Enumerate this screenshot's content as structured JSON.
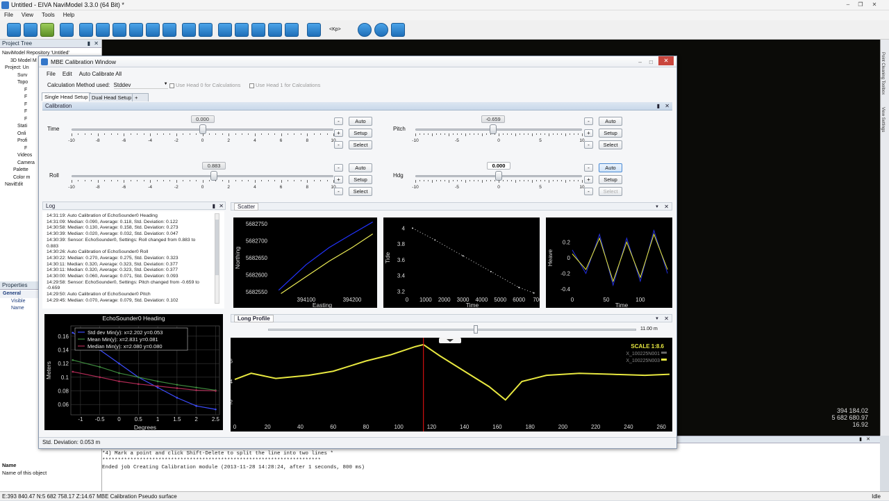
{
  "app": {
    "title": "Untitled - EIVA NaviModel 3.3.0 (64 Bit) *",
    "menu": [
      "File",
      "View",
      "Tools",
      "Help"
    ],
    "kp_label": "<Kp>"
  },
  "project_tree": {
    "title": "Project Tree",
    "items": [
      "NaviModel Repository 'Untitled'",
      "3D Model M",
      "Project: Un",
      "Surv",
      "Topo",
      "F",
      "F",
      "F",
      "F",
      "F",
      "Stati",
      "Onli",
      "Profi",
      "F",
      "Videos",
      "Camera",
      "Palette",
      "Color m",
      "NaviEdit"
    ]
  },
  "properties": {
    "title": "Properties",
    "rows": [
      "General",
      "Visible",
      "Name"
    ],
    "footer_label": "Name",
    "footer_desc": "Name of this object"
  },
  "viewport": {
    "coords": [
      "394 184.02",
      "5 682 680.97",
      "16.92"
    ]
  },
  "right_strip": {
    "tabs": [
      "Point Cleaning Toolbox",
      "View Settings"
    ]
  },
  "output": {
    "lines": [
      "*4) Mark a point and click Shift-Delete to split the line into two lines *",
      "**********************************************************************",
      "Ended job Creating Calibration module (2013-11-28 14:28:24, after 1 seconds, 800 ms)"
    ]
  },
  "status": {
    "left": "E:393 840.47 N:5 682 758.17 Z:14.67 MBE Calibration Pseudo surface",
    "right": "Idle"
  },
  "dialog": {
    "title": "MBE Calibration Window",
    "menu": [
      "File",
      "Edit",
      "Auto Calibrate All"
    ],
    "method_label": "Calculation Method used:",
    "method_value": "Stddev",
    "head0": "Use Head 0 for Calculations",
    "head1": "Use Head 1 for Calculations",
    "tabs": [
      "Single Head Setup",
      "Dual Head Setup",
      "+"
    ],
    "calibration_title": "Calibration",
    "status_text": "Std. Deviation: 0.053 m",
    "sliders": [
      {
        "label": "Time",
        "value": "0.000",
        "fraction": 0.5,
        "ticks": [
          "-10",
          "-8",
          "-6",
          "-4",
          "-2",
          "0",
          "2",
          "4",
          "6",
          "8",
          "10"
        ]
      },
      {
        "label": "Pitch",
        "value": "-0.659",
        "fraction": 0.467,
        "ticks": [
          "-10",
          "-5",
          "0",
          "5",
          "10"
        ]
      },
      {
        "label": "Roll",
        "value": "0.883",
        "fraction": 0.544,
        "ticks": [
          "-10",
          "-8",
          "-6",
          "-4",
          "-2",
          "0",
          "2",
          "4",
          "6",
          "8",
          "10"
        ]
      },
      {
        "label": "Hdg",
        "value": "0.000",
        "fraction": 0.5,
        "ticks": [
          "-10",
          "-5",
          "0",
          "5",
          "10"
        ]
      }
    ],
    "buttons": {
      "auto": "Auto",
      "setup": "Setup",
      "select": "Select",
      "minus": "-",
      "plus": "+"
    },
    "log": {
      "title": "Log",
      "lines": [
        "14:31:19: Auto Calibration of EchoSounder0 Heading",
        "14:31:09: Median: 0.090, Average: 0.118, Std. Deviation: 0.122",
        "14:30:58: Median: 0.130, Average: 0.158, Std. Deviation: 0.273",
        "14:30:39: Median: 0.020, Average: 0.032, Std. Deviation: 0.047",
        "14:30:39: Sensor: EchoSounder0, Settings: Roll changed from 0.883 to",
        "0.883",
        "14:30:26: Auto Calibration of EchoSounder0 Roll",
        "14:30:22: Median: 0.270, Average: 0.275, Std. Deviation: 0.323",
        "14:30:11: Median: 0.320, Average: 0.323, Std. Deviation: 0.377",
        "14:30:11: Median: 0.320, Average: 0.323, Std. Deviation: 0.377",
        "14:30:00: Median: 0.060, Average: 0.071, Std. Deviation: 0.093",
        "14:29:58: Sensor: EchoSounder0, Settings: Pitch changed from -0.659 to",
        "-0.659",
        "14:29:50: Auto Calibration of EchoSounder0 Pitch",
        "14:29:45: Median: 0.070, Average: 0.079, Std. Deviation: 0.102"
      ]
    },
    "scatter_title": "Scatter",
    "long_profile": {
      "title": "Long Profile",
      "slider_label": "11.00 m",
      "scale_label": "SCALE 1:8.6",
      "legend": [
        "X_100225N001",
        "X_100225N003"
      ]
    }
  },
  "chart_data": [
    {
      "type": "line",
      "title": "EchoSounder0 Heading",
      "xlabel": "Degrees",
      "ylabel": "Meters",
      "xlim": [
        -1.25,
        2.6
      ],
      "ylim": [
        0.045,
        0.175
      ],
      "xticks": [
        "-1",
        "-0.5",
        "0",
        "0.5",
        "1",
        "1.5",
        "2",
        "2.5"
      ],
      "yticks": [
        "0.16",
        "0.14",
        "0.12",
        "0.1",
        "0.08",
        "0.06"
      ],
      "legend": [
        "Std dev   Min(y): x=2.202   y=0.053",
        "Mean      Min(y): x=2.831   y=0.081",
        "Median    Min(y): x=2.080   y=0.080"
      ],
      "series": [
        {
          "name": "Std dev",
          "color": "#3d4dff",
          "x": [
            -1.2,
            -0.5,
            0,
            0.5,
            1,
            1.5,
            2,
            2.5
          ],
          "y": [
            0.165,
            0.14,
            0.12,
            0.1,
            0.085,
            0.07,
            0.058,
            0.053
          ]
        },
        {
          "name": "Mean",
          "color": "#3e8a3e",
          "x": [
            -1.2,
            -0.5,
            0,
            0.5,
            1,
            1.5,
            2,
            2.5
          ],
          "y": [
            0.125,
            0.115,
            0.106,
            0.1,
            0.094,
            0.089,
            0.085,
            0.081
          ]
        },
        {
          "name": "Median",
          "color": "#b02a55",
          "x": [
            -1.2,
            -0.5,
            0,
            0.5,
            1,
            1.5,
            2,
            2.5
          ],
          "y": [
            0.108,
            0.1,
            0.094,
            0.09,
            0.087,
            0.084,
            0.081,
            0.08
          ]
        }
      ]
    },
    {
      "type": "scatter",
      "xlabel": "Easting",
      "ylabel": "Northing",
      "xlim": [
        394020,
        394250
      ],
      "ylim": [
        5682540,
        5682760
      ],
      "xticks": [
        "394100",
        "394200"
      ],
      "yticks": [
        "5682750",
        "5682700",
        "5682650",
        "5682600",
        "5682550"
      ],
      "series": [
        {
          "name": "Head",
          "color": "#2233ff",
          "x": [
            394040,
            394100,
            394150,
            394200,
            394245
          ],
          "y": [
            5682555,
            5682630,
            5682680,
            5682720,
            5682755
          ]
        },
        {
          "name": "Track",
          "color": "#eeee55",
          "x": [
            394045,
            394100,
            394150,
            394200,
            394245
          ],
          "y": [
            5682545,
            5682595,
            5682640,
            5682680,
            5682720
          ]
        }
      ]
    },
    {
      "type": "scatter",
      "xlabel": "Time",
      "ylabel": "Tide",
      "xlim": [
        0,
        7000
      ],
      "ylim": [
        3.15,
        4.1
      ],
      "xticks": [
        "0",
        "1000",
        "2000",
        "3000",
        "4000",
        "5000",
        "6000",
        "700"
      ],
      "yticks": [
        "4",
        "3.8",
        "3.6",
        "3.4",
        "3.2"
      ],
      "series": [
        {
          "name": "Tide",
          "color": "#dddddd",
          "x": [
            300,
            1500,
            3000,
            4500,
            6000,
            6800
          ],
          "y": [
            4.0,
            3.85,
            3.65,
            3.45,
            3.25,
            3.18
          ]
        }
      ]
    },
    {
      "type": "line",
      "xlabel": "Time",
      "ylabel": "Heave",
      "xlim": [
        0,
        145
      ],
      "ylim": [
        -0.48,
        0.48
      ],
      "xticks": [
        "0",
        "50",
        "100"
      ],
      "yticks": [
        "0.2",
        "0",
        "-0.2",
        "-0.4"
      ],
      "series": [
        {
          "name": "Heave raw",
          "color": "#2230e0",
          "x": [
            0,
            20,
            40,
            60,
            80,
            100,
            120,
            140
          ],
          "y": [
            0.1,
            -0.2,
            0.3,
            -0.35,
            0.25,
            -0.3,
            0.35,
            -0.2
          ]
        },
        {
          "name": "Heave",
          "color": "#eeee33",
          "x": [
            0,
            20,
            40,
            60,
            80,
            100,
            120,
            140
          ],
          "y": [
            0.05,
            -0.15,
            0.25,
            -0.3,
            0.2,
            -0.25,
            0.3,
            -0.15
          ]
        }
      ]
    },
    {
      "type": "line",
      "title": "",
      "xlim": [
        0,
        265
      ],
      "ylim": [
        10,
        18
      ],
      "xticks": [
        "0",
        "20",
        "40",
        "60",
        "80",
        "100",
        "120",
        "140",
        "160",
        "180",
        "200",
        "220",
        "240",
        "260"
      ],
      "yticks": [
        "12",
        "14",
        "16"
      ],
      "cursor_x": 115,
      "series": [
        {
          "name": "X_100225N003",
          "color": "#e8e840",
          "x": [
            0,
            10,
            25,
            45,
            60,
            80,
            95,
            110,
            115,
            125,
            140,
            155,
            165,
            175,
            190,
            210,
            230,
            250,
            265
          ],
          "y": [
            14.2,
            14.8,
            14.3,
            14.6,
            15.0,
            16.0,
            16.6,
            17.4,
            17.6,
            16.5,
            15.0,
            13.5,
            12.2,
            14.0,
            14.6,
            14.8,
            14.7,
            14.6,
            14.7
          ]
        }
      ]
    }
  ]
}
